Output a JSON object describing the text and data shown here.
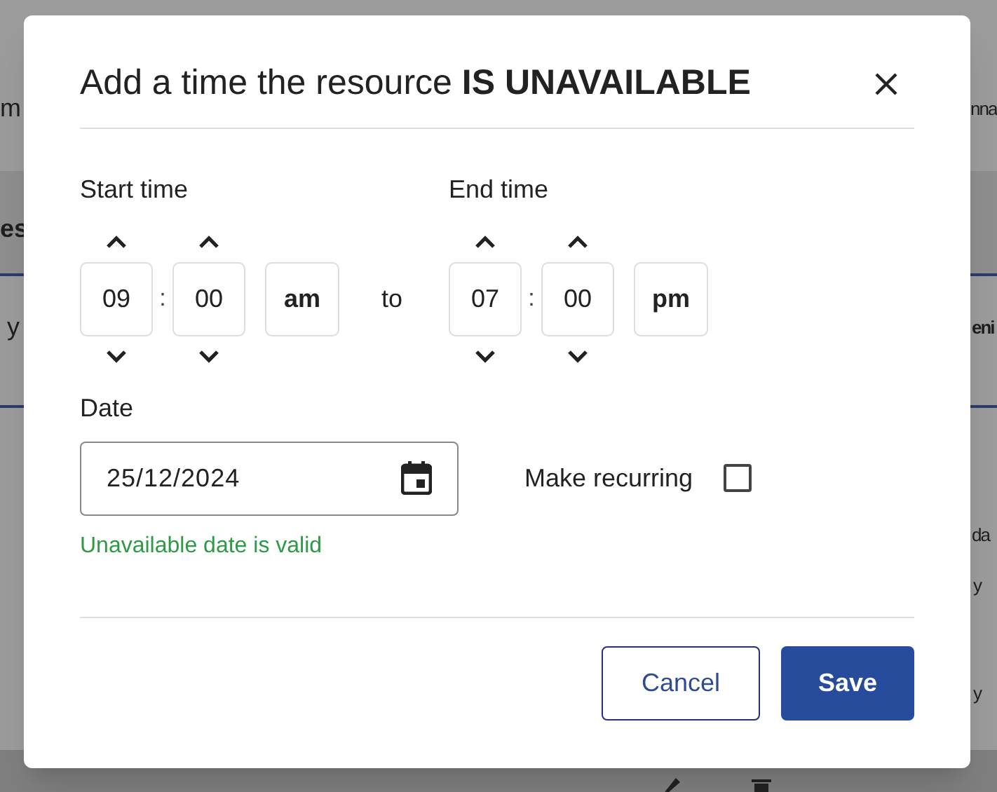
{
  "background": {
    "left_texts": [
      {
        "text": "m",
        "bold": false
      },
      {
        "text": "es",
        "bold": true
      },
      {
        "text": "y",
        "bold": false
      }
    ],
    "right_texts": [
      {
        "text": "nna",
        "bold": false
      },
      {
        "text": "eni",
        "bold": true
      },
      {
        "text": "da",
        "bold": false
      },
      {
        "text": "y",
        "bold": false
      },
      {
        "text": "y",
        "bold": false
      }
    ]
  },
  "dialog": {
    "title": "Add a time the resource **IS UNAVAILABLE**",
    "start_time": {
      "label": "Start time",
      "hour": "09",
      "colon": ":",
      "minute": "00",
      "period": "am"
    },
    "separator": "to",
    "end_time": {
      "label": "End time",
      "hour": "07",
      "colon": ":",
      "minute": "00",
      "period": "pm"
    },
    "date": {
      "label": "Date",
      "value": "25/12/2024",
      "helper": "Unavailable date is valid",
      "valid": true
    },
    "recurring": {
      "label": "Make recurring",
      "checked": false
    },
    "buttons": [
      {
        "label": "Cancel",
        "kind": "secondary"
      },
      {
        "label": "Save",
        "kind": "primary"
      }
    ]
  }
}
